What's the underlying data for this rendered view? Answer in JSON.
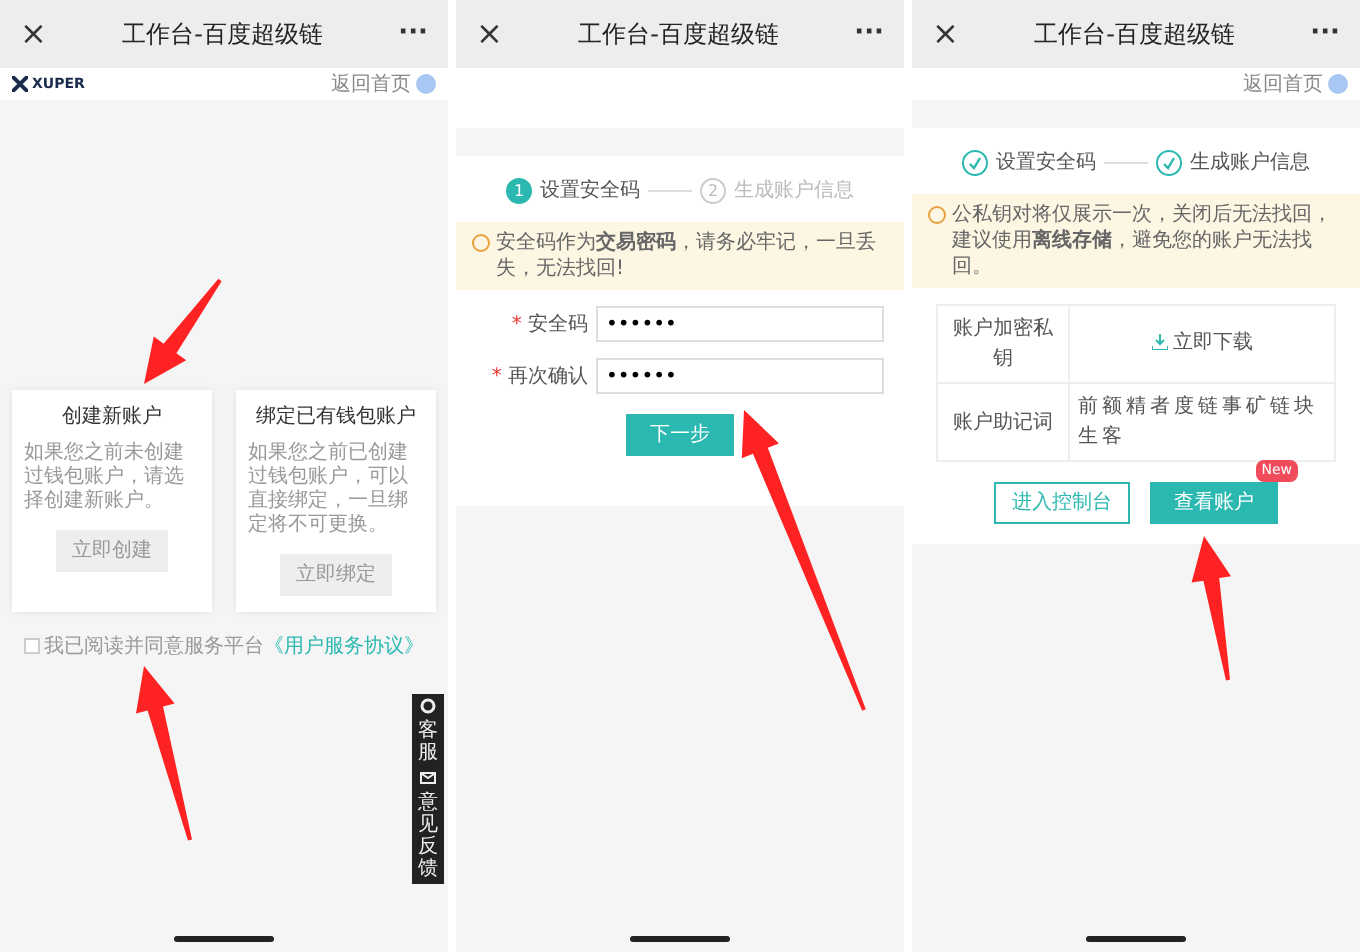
{
  "panels": [
    {
      "kind": "select-account",
      "title_bar": {
        "close": "×",
        "title": "工作台-百度超级链",
        "more": "···"
      },
      "header": {
        "logo": "XUPER",
        "home_link": "返回首页"
      },
      "cards": [
        {
          "title": "创建新账户",
          "text": "如果您之前未创建过钱包账户，请选择创建新账户。",
          "button": "立即创建"
        },
        {
          "title": "绑定已有钱包账户",
          "text": "如果您之前已创建过钱包账户，可以直接绑定，一旦绑定将不可更换。",
          "button": "立即绑定"
        }
      ],
      "agreement": {
        "checked": false,
        "text": "我已阅读并同意服务平台",
        "link": "《用户服务协议》"
      },
      "float_menu": [
        "客服",
        "意见反馈"
      ]
    },
    {
      "kind": "set-code",
      "title_bar": {
        "close": "×",
        "title": "工作台-百度超级链",
        "more": "···"
      },
      "steps": [
        {
          "number": "1",
          "label": "设置安全码",
          "active": true,
          "done": false
        },
        {
          "number": "2",
          "label": "生成账户信息",
          "active": false,
          "done": false
        }
      ],
      "notice": "安全码作为**交易密码**，请务必牢记，一旦丢失，无法找回!",
      "fields": [
        {
          "marker": "*",
          "label": "安全码",
          "value": "••••••"
        },
        {
          "marker": "*",
          "label": "再次确认",
          "value": "••••••"
        }
      ],
      "button": "下一步"
    },
    {
      "kind": "account-info",
      "title_bar": {
        "close": "×",
        "title": "工作台-百度超级链",
        "more": "···"
      },
      "header": {
        "home_link": "返回首页"
      },
      "steps": [
        {
          "label": "设置安全码",
          "active": false,
          "done": true
        },
        {
          "label": "生成账户信息",
          "active": false,
          "done": true
        }
      ],
      "notice": "公私钥对将仅展示一次，关闭后无法找回，建议使用**离线存储**，避免您的账户无法找回。",
      "table": [
        {
          "label": "账户加密私钥",
          "value": "立即下载",
          "kind": "download"
        },
        {
          "label": "账户助记词",
          "value": "前额精者度链事矿链块生客",
          "kind": "text"
        }
      ],
      "buttons": [
        {
          "label": "进入控制台",
          "kind": "outline"
        },
        {
          "label": "查看账户",
          "kind": "primary",
          "badge": "New"
        }
      ]
    }
  ]
}
